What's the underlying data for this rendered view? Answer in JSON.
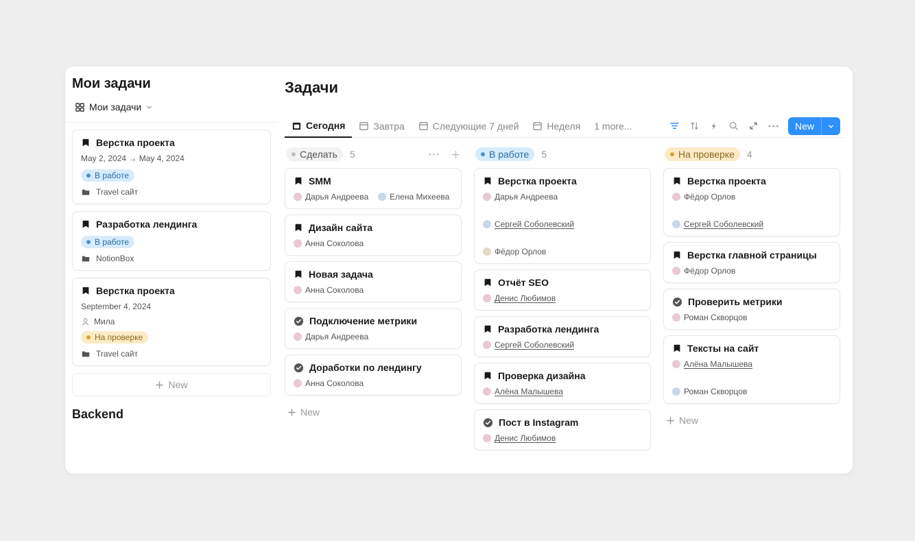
{
  "sidebar": {
    "title": "Мои задачи",
    "view_label": "Мои задачи",
    "new_label": "New",
    "backend_heading": "Backend",
    "cards": [
      {
        "title": "Верстка проекта",
        "date": "May 2, 2024 → May 4, 2024",
        "status": "В работе",
        "folder": "Travel сайт"
      },
      {
        "title": "Разработка лендинга",
        "status": "В работе",
        "folder": "NotionBox"
      },
      {
        "title": "Верстка проекта",
        "date": "September 4, 2024",
        "assignee": "Мила",
        "status": "На проверке",
        "folder": "Travel сайт"
      }
    ]
  },
  "main": {
    "title": "Задачи",
    "tabs": {
      "today": "Сегодня",
      "tomorrow": "Завтра",
      "next7": "Следующие 7 дней",
      "week": "Неделя",
      "more": "1 more..."
    },
    "new_button": "New"
  },
  "columns": {
    "todo": {
      "title": "Сделать",
      "count": "5",
      "add_label": "New",
      "cards": [
        {
          "title": "SMM",
          "assignees": [
            "Дарья Андреева",
            "Елена Михеева"
          ]
        },
        {
          "title": "Дизайн сайта",
          "assignees": [
            "Анна Соколова"
          ]
        },
        {
          "title": "Новая задача",
          "assignees": [
            "Анна Соколова"
          ]
        },
        {
          "title": "Подключение метрики",
          "done": true,
          "assignees": [
            "Дарья Андреева"
          ]
        },
        {
          "title": "Доработки по лендингу",
          "done": true,
          "assignees": [
            "Анна Соколова"
          ]
        }
      ]
    },
    "inwork": {
      "title": "В работе",
      "count": "5",
      "cards": [
        {
          "title": "Верстка проекта",
          "assignees": [
            "Дарья Андреева",
            "Сергей Соболевский",
            "Фёдор Орлов"
          ]
        },
        {
          "title": "Отчёт SEO",
          "assignees": [
            "Денис Любимов"
          ]
        },
        {
          "title": "Разработка лендинга",
          "assignees": [
            "Сергей Соболевский"
          ]
        },
        {
          "title": "Проверка дизайна",
          "assignees": [
            "Алёна Малышева"
          ]
        },
        {
          "title": "Пост в Instagram",
          "done": true,
          "assignees": [
            "Денис Любимов"
          ]
        }
      ]
    },
    "review": {
      "title": "На проверке",
      "count": "4",
      "add_label": "New",
      "cards": [
        {
          "title": "Верстка проекта",
          "assignees": [
            "Фёдор Орлов",
            "Сергей Соболевский"
          ]
        },
        {
          "title": "Верстка главной страницы",
          "assignees": [
            "Фёдор Орлов"
          ]
        },
        {
          "title": "Проверить метрики",
          "done": true,
          "assignees": [
            "Роман Скворцов"
          ]
        },
        {
          "title": "Тексты на сайт",
          "assignees": [
            "Алёна Малышева",
            "Роман Скворцов"
          ]
        }
      ]
    }
  },
  "underlined_assignees": [
    "Сергей Соболевский",
    "Денис Любимов",
    "Алёна Малышева"
  ]
}
